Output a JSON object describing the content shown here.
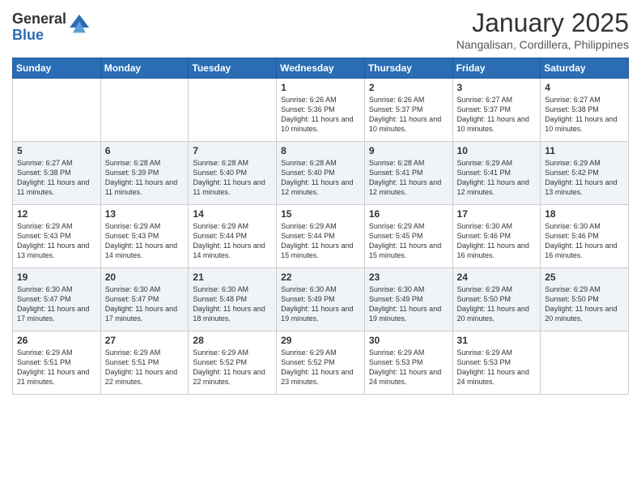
{
  "header": {
    "logo_general": "General",
    "logo_blue": "Blue",
    "month": "January 2025",
    "location": "Nangalisan, Cordillera, Philippines"
  },
  "weekdays": [
    "Sunday",
    "Monday",
    "Tuesday",
    "Wednesday",
    "Thursday",
    "Friday",
    "Saturday"
  ],
  "weeks": [
    [
      {
        "day": "",
        "text": ""
      },
      {
        "day": "",
        "text": ""
      },
      {
        "day": "",
        "text": ""
      },
      {
        "day": "1",
        "text": "Sunrise: 6:26 AM\nSunset: 5:36 PM\nDaylight: 11 hours and 10 minutes."
      },
      {
        "day": "2",
        "text": "Sunrise: 6:26 AM\nSunset: 5:37 PM\nDaylight: 11 hours and 10 minutes."
      },
      {
        "day": "3",
        "text": "Sunrise: 6:27 AM\nSunset: 5:37 PM\nDaylight: 11 hours and 10 minutes."
      },
      {
        "day": "4",
        "text": "Sunrise: 6:27 AM\nSunset: 5:38 PM\nDaylight: 11 hours and 10 minutes."
      }
    ],
    [
      {
        "day": "5",
        "text": "Sunrise: 6:27 AM\nSunset: 5:38 PM\nDaylight: 11 hours and 11 minutes."
      },
      {
        "day": "6",
        "text": "Sunrise: 6:28 AM\nSunset: 5:39 PM\nDaylight: 11 hours and 11 minutes."
      },
      {
        "day": "7",
        "text": "Sunrise: 6:28 AM\nSunset: 5:40 PM\nDaylight: 11 hours and 11 minutes."
      },
      {
        "day": "8",
        "text": "Sunrise: 6:28 AM\nSunset: 5:40 PM\nDaylight: 11 hours and 12 minutes."
      },
      {
        "day": "9",
        "text": "Sunrise: 6:28 AM\nSunset: 5:41 PM\nDaylight: 11 hours and 12 minutes."
      },
      {
        "day": "10",
        "text": "Sunrise: 6:29 AM\nSunset: 5:41 PM\nDaylight: 11 hours and 12 minutes."
      },
      {
        "day": "11",
        "text": "Sunrise: 6:29 AM\nSunset: 5:42 PM\nDaylight: 11 hours and 13 minutes."
      }
    ],
    [
      {
        "day": "12",
        "text": "Sunrise: 6:29 AM\nSunset: 5:43 PM\nDaylight: 11 hours and 13 minutes."
      },
      {
        "day": "13",
        "text": "Sunrise: 6:29 AM\nSunset: 5:43 PM\nDaylight: 11 hours and 14 minutes."
      },
      {
        "day": "14",
        "text": "Sunrise: 6:29 AM\nSunset: 5:44 PM\nDaylight: 11 hours and 14 minutes."
      },
      {
        "day": "15",
        "text": "Sunrise: 6:29 AM\nSunset: 5:44 PM\nDaylight: 11 hours and 15 minutes."
      },
      {
        "day": "16",
        "text": "Sunrise: 6:29 AM\nSunset: 5:45 PM\nDaylight: 11 hours and 15 minutes."
      },
      {
        "day": "17",
        "text": "Sunrise: 6:30 AM\nSunset: 5:46 PM\nDaylight: 11 hours and 16 minutes."
      },
      {
        "day": "18",
        "text": "Sunrise: 6:30 AM\nSunset: 5:46 PM\nDaylight: 11 hours and 16 minutes."
      }
    ],
    [
      {
        "day": "19",
        "text": "Sunrise: 6:30 AM\nSunset: 5:47 PM\nDaylight: 11 hours and 17 minutes."
      },
      {
        "day": "20",
        "text": "Sunrise: 6:30 AM\nSunset: 5:47 PM\nDaylight: 11 hours and 17 minutes."
      },
      {
        "day": "21",
        "text": "Sunrise: 6:30 AM\nSunset: 5:48 PM\nDaylight: 11 hours and 18 minutes."
      },
      {
        "day": "22",
        "text": "Sunrise: 6:30 AM\nSunset: 5:49 PM\nDaylight: 11 hours and 19 minutes."
      },
      {
        "day": "23",
        "text": "Sunrise: 6:30 AM\nSunset: 5:49 PM\nDaylight: 11 hours and 19 minutes."
      },
      {
        "day": "24",
        "text": "Sunrise: 6:29 AM\nSunset: 5:50 PM\nDaylight: 11 hours and 20 minutes."
      },
      {
        "day": "25",
        "text": "Sunrise: 6:29 AM\nSunset: 5:50 PM\nDaylight: 11 hours and 20 minutes."
      }
    ],
    [
      {
        "day": "26",
        "text": "Sunrise: 6:29 AM\nSunset: 5:51 PM\nDaylight: 11 hours and 21 minutes."
      },
      {
        "day": "27",
        "text": "Sunrise: 6:29 AM\nSunset: 5:51 PM\nDaylight: 11 hours and 22 minutes."
      },
      {
        "day": "28",
        "text": "Sunrise: 6:29 AM\nSunset: 5:52 PM\nDaylight: 11 hours and 22 minutes."
      },
      {
        "day": "29",
        "text": "Sunrise: 6:29 AM\nSunset: 5:52 PM\nDaylight: 11 hours and 23 minutes."
      },
      {
        "day": "30",
        "text": "Sunrise: 6:29 AM\nSunset: 5:53 PM\nDaylight: 11 hours and 24 minutes."
      },
      {
        "day": "31",
        "text": "Sunrise: 6:29 AM\nSunset: 5:53 PM\nDaylight: 11 hours and 24 minutes."
      },
      {
        "day": "",
        "text": ""
      }
    ]
  ]
}
